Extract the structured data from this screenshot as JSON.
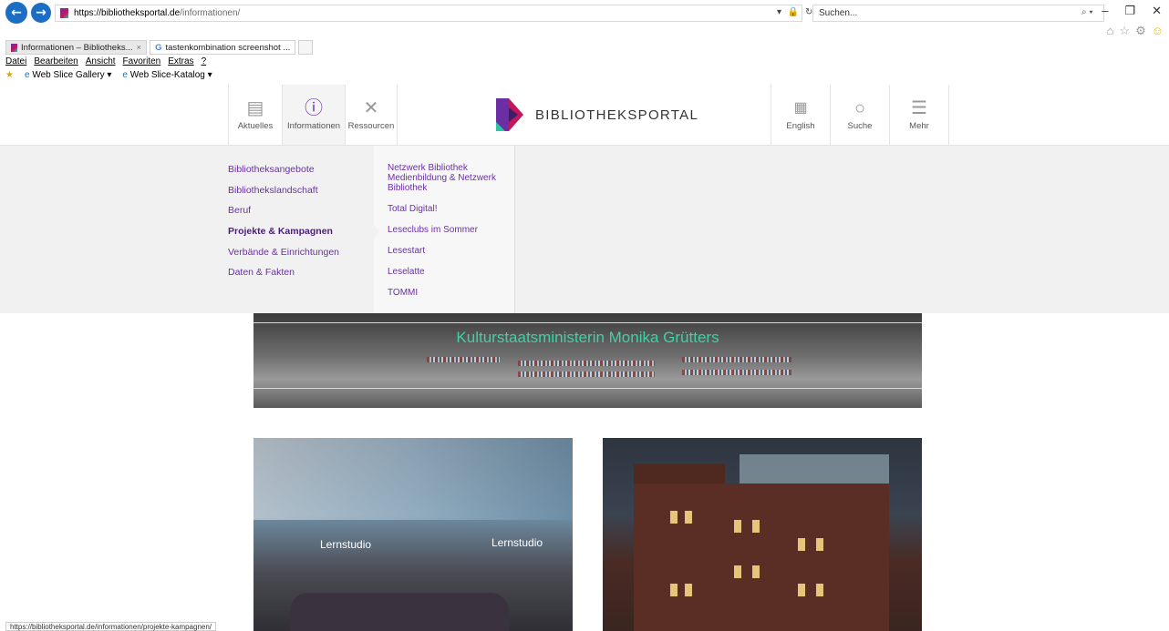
{
  "browser": {
    "url_host": "https://bibliotheksportal.de",
    "url_path": "/informationen/",
    "search_placeholder": "Suchen...",
    "tabs": [
      {
        "label": "Informationen – Bibliotheks...",
        "close": "×"
      },
      {
        "label": "tastenkombination screenshot ..."
      }
    ],
    "menu": [
      "Datei",
      "Bearbeiten",
      "Ansicht",
      "Favoriten",
      "Extras",
      "?"
    ],
    "favorites": [
      "Web Slice Gallery ▾",
      "Web Slice-Katalog ▾"
    ],
    "status_url": "https://bibliotheksportal.de/informationen/projekte-kampagnen/"
  },
  "site": {
    "nav_left": [
      {
        "label": "Aktuelles",
        "icon": "news-icon"
      },
      {
        "label": "Informationen",
        "icon": "info-icon"
      },
      {
        "label": "Ressourcen",
        "icon": "tools-icon"
      }
    ],
    "logo_text": "BIBLIOTHEKSPORTAL",
    "nav_right": [
      {
        "label": "English",
        "icon": "uk-flag-icon"
      },
      {
        "label": "Suche",
        "icon": "search-icon"
      },
      {
        "label": "Mehr",
        "icon": "hamburger-icon"
      }
    ],
    "colors": {
      "accent": "#6b2fa3",
      "banner_text": "#3fd1a8"
    }
  },
  "dropdown": {
    "col1": [
      "Bibliotheksangebote",
      "Bibliothekslandschaft",
      "Beruf",
      "Projekte & Kampagnen",
      "Verbände & Einrichtungen",
      "Daten & Fakten"
    ],
    "active_index": 3,
    "col2": [
      "Netzwerk Bibliothek Medienbildung & Netzwerk Bibliothek",
      "Total Digital!",
      "Leseclubs im Sommer",
      "Lesestart",
      "Leselatte",
      "TOMMI"
    ]
  },
  "content": {
    "banner_text": "Kulturstaatsministerin Monika Grütters",
    "card1_signs": [
      "Lernstudio",
      "Lernstudio"
    ]
  }
}
